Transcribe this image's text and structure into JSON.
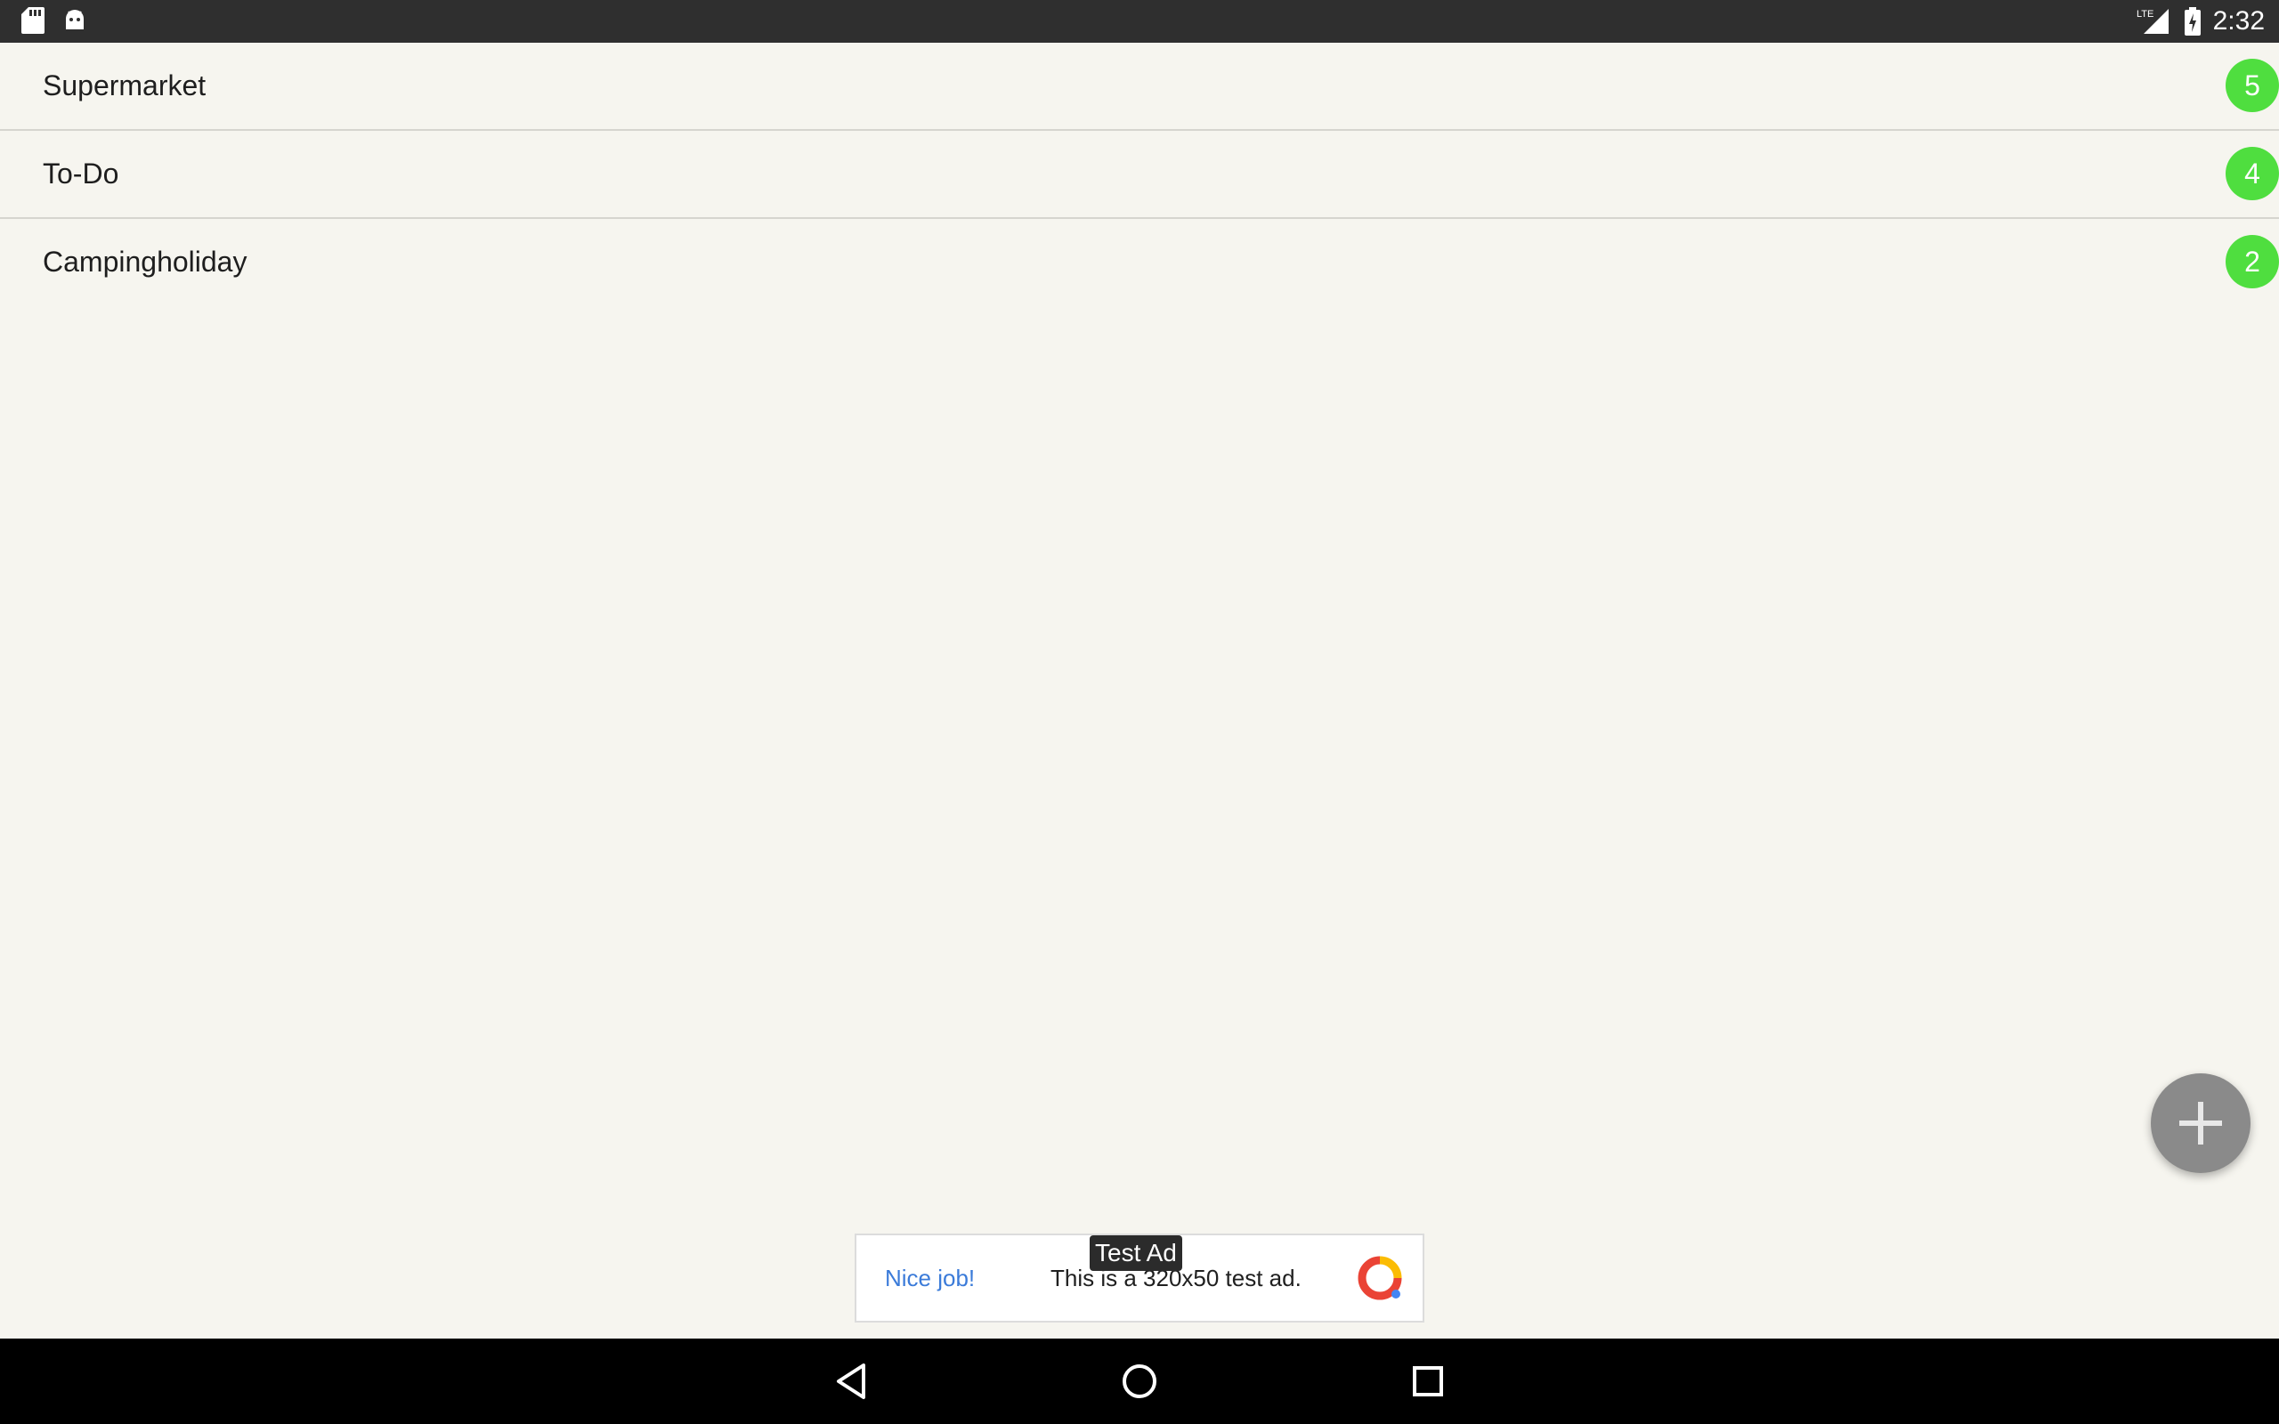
{
  "status_bar": {
    "time": "2:32",
    "network": "LTE",
    "left_icons": [
      "sd-card-icon",
      "android-icon"
    ],
    "right_icons": [
      "signal-icon",
      "battery-charging-icon"
    ]
  },
  "lists": [
    {
      "name": "Supermarket",
      "count": "5"
    },
    {
      "name": "To-Do",
      "count": "4"
    },
    {
      "name": "Campingholiday",
      "count": "2"
    }
  ],
  "fab": {
    "icon": "plus-icon"
  },
  "ad": {
    "tag": "Test Ad",
    "headline": "Nice job!",
    "text": "This is a 320x50 test ad.",
    "icon": "ad-logo-icon"
  },
  "nav": {
    "back": "back-icon",
    "home": "home-icon",
    "recents": "recents-icon"
  },
  "colors": {
    "background": "#f6f5ef",
    "badge": "#4fde3f",
    "fab": "#8a8a8a",
    "ad_link": "#3b7bd9"
  }
}
